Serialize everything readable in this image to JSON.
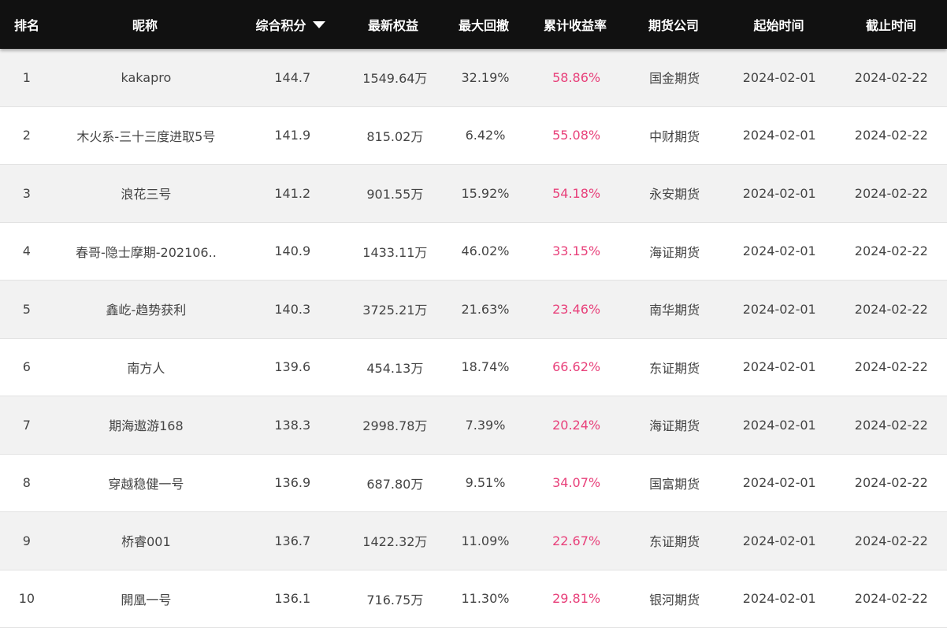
{
  "header": {
    "columns": [
      "排名",
      "昵称",
      "综合积分",
      "最新权益",
      "最大回撤",
      "累计收益率",
      "期货公司",
      "起始时间",
      "截止时间"
    ],
    "sort_icon": "caret-down-icon"
  },
  "colors": {
    "header_bg": "#111111",
    "stripe_bg": "#f2f2f2",
    "return_color": "#e8407a"
  },
  "rows": [
    [
      "1",
      "kakapro",
      "144.7",
      "1549.64万",
      "32.19%",
      "58.86%",
      "国金期货",
      "2024-02-01",
      "2024-02-22"
    ],
    [
      "2",
      "木火系-三十三度进取5号",
      "141.9",
      "815.02万",
      "6.42%",
      "55.08%",
      "中财期货",
      "2024-02-01",
      "2024-02-22"
    ],
    [
      "3",
      "浪花三号",
      "141.2",
      "901.55万",
      "15.92%",
      "54.18%",
      "永安期货",
      "2024-02-01",
      "2024-02-22"
    ],
    [
      "4",
      "春哥-隐士摩期-202106..",
      "140.9",
      "1433.11万",
      "46.02%",
      "33.15%",
      "海证期货",
      "2024-02-01",
      "2024-02-22"
    ],
    [
      "5",
      "鑫屹-趋势获利",
      "140.3",
      "3725.21万",
      "21.63%",
      "23.46%",
      "南华期货",
      "2024-02-01",
      "2024-02-22"
    ],
    [
      "6",
      "南方人",
      "139.6",
      "454.13万",
      "18.74%",
      "66.62%",
      "东证期货",
      "2024-02-01",
      "2024-02-22"
    ],
    [
      "7",
      "期海遨游168",
      "138.3",
      "2998.78万",
      "7.39%",
      "20.24%",
      "海证期货",
      "2024-02-01",
      "2024-02-22"
    ],
    [
      "8",
      "穿越稳健一号",
      "136.9",
      "687.80万",
      "9.51%",
      "34.07%",
      "国富期货",
      "2024-02-01",
      "2024-02-22"
    ],
    [
      "9",
      "桥睿001",
      "136.7",
      "1422.32万",
      "11.09%",
      "22.67%",
      "东证期货",
      "2024-02-01",
      "2024-02-22"
    ],
    [
      "10",
      "開凰一号",
      "136.1",
      "716.75万",
      "11.30%",
      "29.81%",
      "银河期货",
      "2024-02-01",
      "2024-02-22"
    ]
  ]
}
